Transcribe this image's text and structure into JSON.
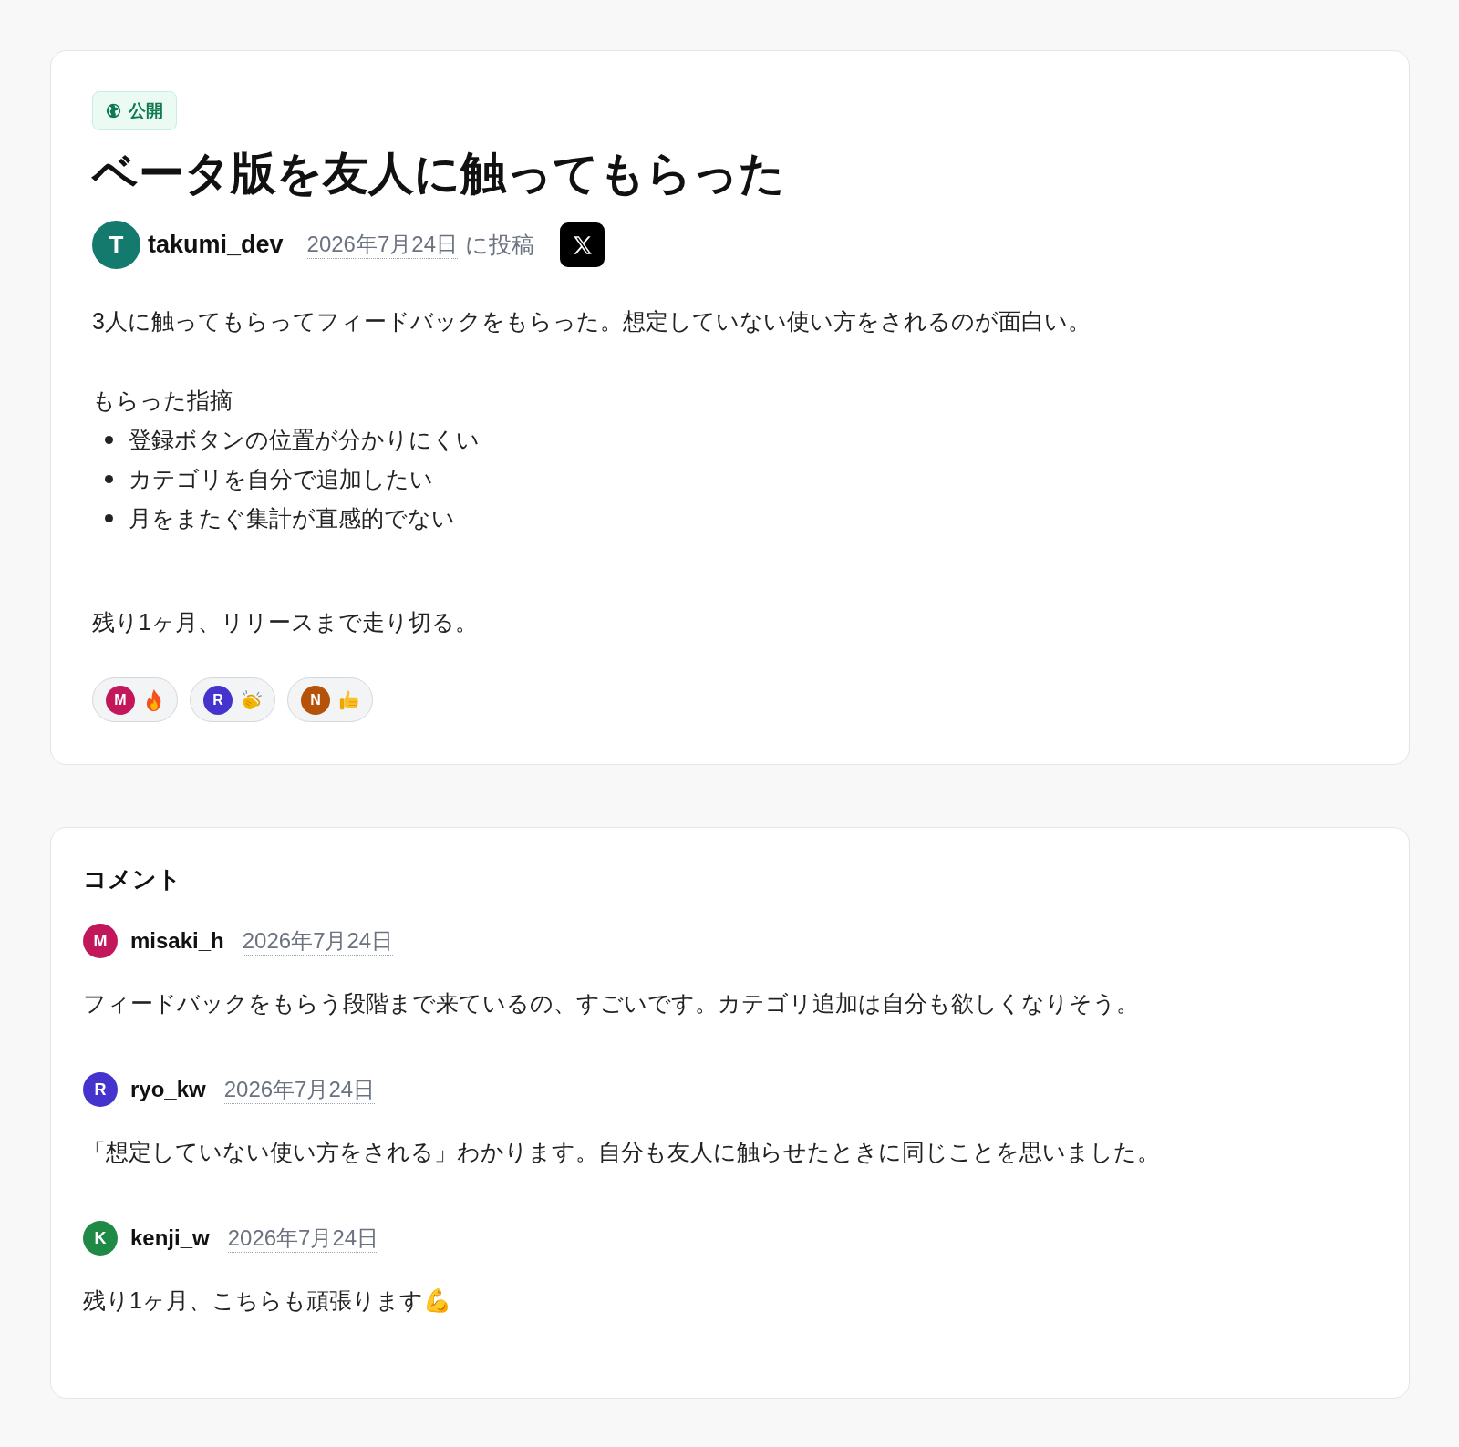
{
  "post": {
    "badge": {
      "kind": "public",
      "label": "公開"
    },
    "title": "ベータ版を友人に触ってもらった",
    "author": {
      "initial": "T",
      "color": "#157a6e",
      "name": "takumi_dev"
    },
    "date": "2026年7月24日",
    "posted_label": "に投稿",
    "share": {
      "kind": "x"
    },
    "body": [
      {
        "kind": "paragraph",
        "text": "3人に触ってもらってフィードバックをもらった。想定していない使い方をされるのが面白い。"
      },
      {
        "kind": "heading",
        "text": "もらった指摘"
      },
      {
        "kind": "list",
        "items": [
          "登録ボタンの位置が分かりにくい",
          "カテゴリを自分で追加したい",
          "月をまたぐ集計が直感的でない"
        ]
      },
      {
        "kind": "closing",
        "text": "残り1ヶ月、リリースまで走り切る。"
      }
    ],
    "reactions": [
      {
        "initial": "M",
        "color": "#c2185b",
        "kind": "fire"
      },
      {
        "initial": "R",
        "color": "#4433cc",
        "kind": "clap"
      },
      {
        "initial": "N",
        "color": "#b45309",
        "kind": "thumbs_up"
      }
    ]
  },
  "comments": {
    "heading": "コメント",
    "items": [
      {
        "initial": "M",
        "color": "#c2185b",
        "name": "misaki_h",
        "date": "2026年7月24日",
        "text": "フィードバックをもらう段階まで来ているの、すごいです。カテゴリ追加は自分も欲しくなりそう。"
      },
      {
        "initial": "R",
        "color": "#4433cc",
        "name": "ryo_kw",
        "date": "2026年7月24日",
        "text": "「想定していない使い方をされる」わかります。自分も友人に触らせたときに同じことを思いました。"
      },
      {
        "initial": "K",
        "color": "#1e8a45",
        "name": "kenji_w",
        "date": "2026年7月24日",
        "text": "残り1ヶ月、こちらも頑張ります💪"
      }
    ]
  }
}
